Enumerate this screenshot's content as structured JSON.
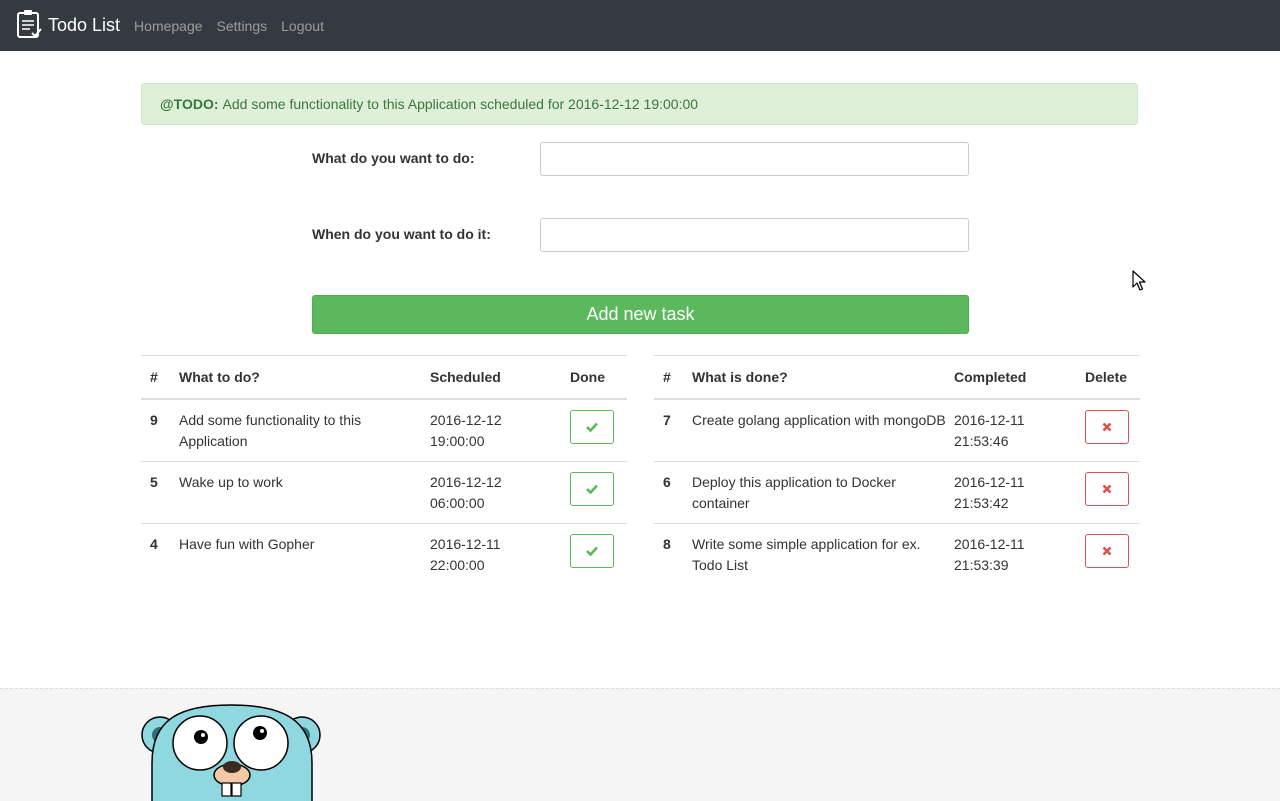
{
  "navbar": {
    "brand": "Todo List",
    "links": [
      "Homepage",
      "Settings",
      "Logout"
    ]
  },
  "alert": {
    "tag": "@TODO:",
    "message": "Add some functionality to this Application scheduled for 2016-12-12 19:00:00"
  },
  "form": {
    "what_label": "What do you want to do:",
    "what_value": "",
    "when_label": "When do you want to do it:",
    "when_value": "",
    "submit_label": "Add new task"
  },
  "todo_table": {
    "headers": [
      "#",
      "What to do?",
      "Scheduled",
      "Done"
    ],
    "rows": [
      {
        "id": "9",
        "task": "Add some functionality to this Application",
        "date": "2016-12-12",
        "time": "19:00:00"
      },
      {
        "id": "5",
        "task": "Wake up to work",
        "date": "2016-12-12",
        "time": "06:00:00"
      },
      {
        "id": "4",
        "task": "Have fun with Gopher",
        "date": "2016-12-11",
        "time": "22:00:00"
      }
    ]
  },
  "done_table": {
    "headers": [
      "#",
      "What is done?",
      "Completed",
      "Delete"
    ],
    "rows": [
      {
        "id": "7",
        "task": "Create golang application with mongoDB",
        "date": "2016-12-11",
        "time": "21:53:46"
      },
      {
        "id": "6",
        "task": "Deploy this application to Docker container",
        "date": "2016-12-11",
        "time": "21:53:42"
      },
      {
        "id": "8",
        "task": "Write some simple application for ex. Todo List",
        "date": "2016-12-11",
        "time": "21:53:39"
      }
    ]
  },
  "colors": {
    "navbar_bg": "#343a40",
    "success": "#5cb85c",
    "danger": "#d9534f",
    "alert_bg": "#dff0d8",
    "alert_text": "#3c763d"
  },
  "icons": {
    "brand": "clipboard-icon",
    "done": "check-icon",
    "delete": "times-icon",
    "footer": "gopher-mascot"
  }
}
